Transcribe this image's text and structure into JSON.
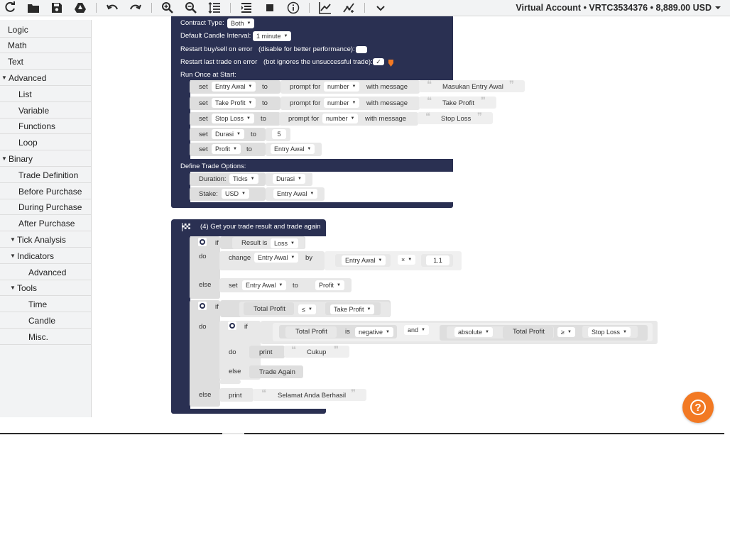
{
  "toolbar": {
    "icons": [
      "reset-icon",
      "load-icon",
      "save-icon",
      "google-drive-icon",
      "undo-icon",
      "redo-icon",
      "zoom-in-icon",
      "zoom-out-icon",
      "sort-blocks-icon",
      "logs-icon",
      "stop-icon",
      "info-icon",
      "chart-icon",
      "trading-view-icon",
      "more-icon"
    ],
    "account_label": "Virtual Account",
    "account_id": "VRTC3534376",
    "balance": "8,889.00 USD"
  },
  "toolbox": {
    "categories": [
      {
        "label": "Logic"
      },
      {
        "label": "Math"
      },
      {
        "label": "Text"
      },
      {
        "label": "Advanced",
        "expanded": true
      },
      {
        "label": "List"
      },
      {
        "label": "Variable"
      },
      {
        "label": "Functions"
      },
      {
        "label": "Loop"
      },
      {
        "label": "Binary",
        "expanded": true
      },
      {
        "label": "Trade Definition"
      },
      {
        "label": "Before Purchase"
      },
      {
        "label": "During Purchase"
      },
      {
        "label": "After Purchase"
      },
      {
        "label": "Tick Analysis",
        "expanded": true
      },
      {
        "label": "Indicators",
        "expanded": true
      },
      {
        "label": "Advanced"
      },
      {
        "label": "Tools",
        "expanded": true
      },
      {
        "label": "Time"
      },
      {
        "label": "Candle"
      },
      {
        "label": "Misc."
      }
    ]
  },
  "trade_block": {
    "contract_type_label": "Contract Type:",
    "contract_type_value": "Both",
    "candle_interval_label": "Default Candle Interval:",
    "candle_interval_value": "1 minute",
    "restart_buy_label": "Restart buy/sell on error",
    "restart_buy_hint": "(disable for better performance):",
    "restart_last_label": "Restart last trade on error",
    "restart_last_hint": "(bot ignores the unsuccessful trade):",
    "run_once_label": "Run Once at Start:",
    "init_rows": [
      {
        "set": "set",
        "var": "Entry Awal",
        "to": "to",
        "prompt": "prompt for",
        "type": "number",
        "with": "with message",
        "message": "Masukan Entry Awal"
      },
      {
        "set": "set",
        "var": "Take Profit",
        "to": "to",
        "prompt": "prompt for",
        "type": "number",
        "with": "with message",
        "message": "Take Profit"
      },
      {
        "set": "set",
        "var": "Stop Loss",
        "to": "to",
        "prompt": "prompt for",
        "type": "number",
        "with": "with message",
        "message": "Stop Loss"
      }
    ],
    "durasi_row": {
      "set": "set",
      "var": "Durasi",
      "to": "to",
      "value": "5"
    },
    "profit_row": {
      "set": "set",
      "var": "Profit",
      "to": "to",
      "value": "Entry Awal"
    },
    "define_label": "Define Trade Options:",
    "duration_label": "Duration:",
    "duration_unit": "Ticks",
    "duration_value": "Durasi",
    "stake_label": "Stake:",
    "stake_currency": "USD",
    "stake_value": "Entry Awal"
  },
  "after_block": {
    "title": "(4) Get your trade result and trade again",
    "if1": {
      "if": "if",
      "cond_label": "Result is",
      "cond_value": "Loss",
      "do": "do",
      "change": "change",
      "var": "Entry Awal",
      "by": "by",
      "operand": "Entry Awal",
      "op": "×",
      "factor": "1.1",
      "else": "else",
      "set": "set",
      "set_var": "Entry Awal",
      "to": "to",
      "set_value": "Profit"
    },
    "if2": {
      "if": "if",
      "left": "Total Profit",
      "op": "≤",
      "right": "Take Profit",
      "do": "do",
      "else": "else"
    },
    "if3": {
      "if": "if",
      "left": "Total Profit",
      "is": "is",
      "sign": "negative",
      "and": "and",
      "abs": "absolute",
      "abs_arg": "Total Profit",
      "cmp": "≥",
      "right": "Stop Loss",
      "do": "do",
      "print": "print",
      "print_text": "Cukup",
      "else": "else",
      "trade_again": "Trade Again"
    },
    "else_print": "print",
    "else_text": "Selamat Anda Berhasil"
  },
  "help_icon": "help-icon"
}
